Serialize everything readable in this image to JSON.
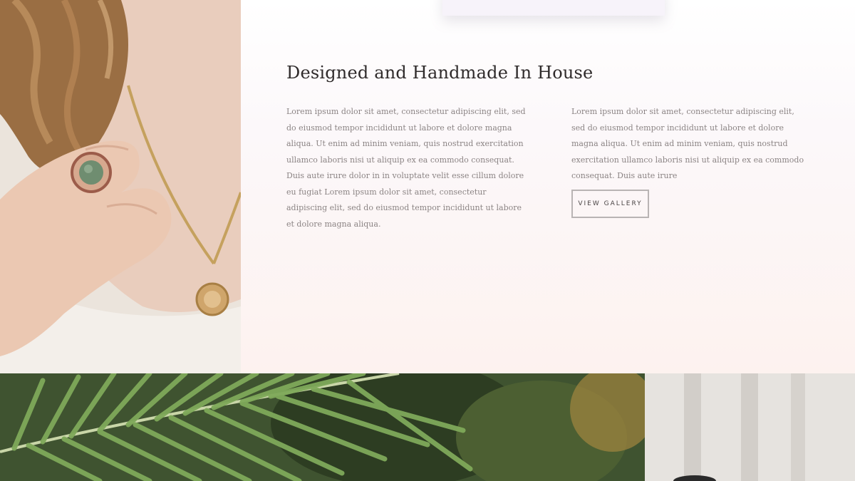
{
  "section": {
    "heading": "Designed and Handmade In House",
    "paragraph_left": "Lorem ipsum dolor sit amet, consectetur adipiscing elit, sed do eiusmod tempor incididunt ut labore et dolore magna aliqua. Ut enim ad minim veniam, quis nostrud exercitation ullamco laboris nisi ut aliquip ex ea commodo consequat. Duis aute irure dolor in in voluptate velit esse cillum dolore eu fugiat Lorem ipsum dolor sit amet, consectetur adipiscing elit, sed do eiusmod tempor incididunt ut labore et dolore magna aliqua.",
    "paragraph_right": "Lorem ipsum dolor sit amet, consectetur adipiscing elit, sed do eiusmod tempor incididunt ut labore et dolore magna aliqua. Ut enim ad minim veniam, quis nostrud exercitation ullamco laboris nisi ut aliquip ex ea commodo consequat. Duis aute irure",
    "button_label": "VIEW GALLERY"
  },
  "images": {
    "left_photo": "woman-wearing-jade-ring-and-pendant-necklace",
    "bottom_photo": "palm-leaf-garden"
  },
  "colors": {
    "heading": "#2f2b2b",
    "body_text": "#8b8484",
    "button_border": "#b9b4b4",
    "background_top": "#ffffff",
    "background_bottom": "#fdf2ef"
  }
}
